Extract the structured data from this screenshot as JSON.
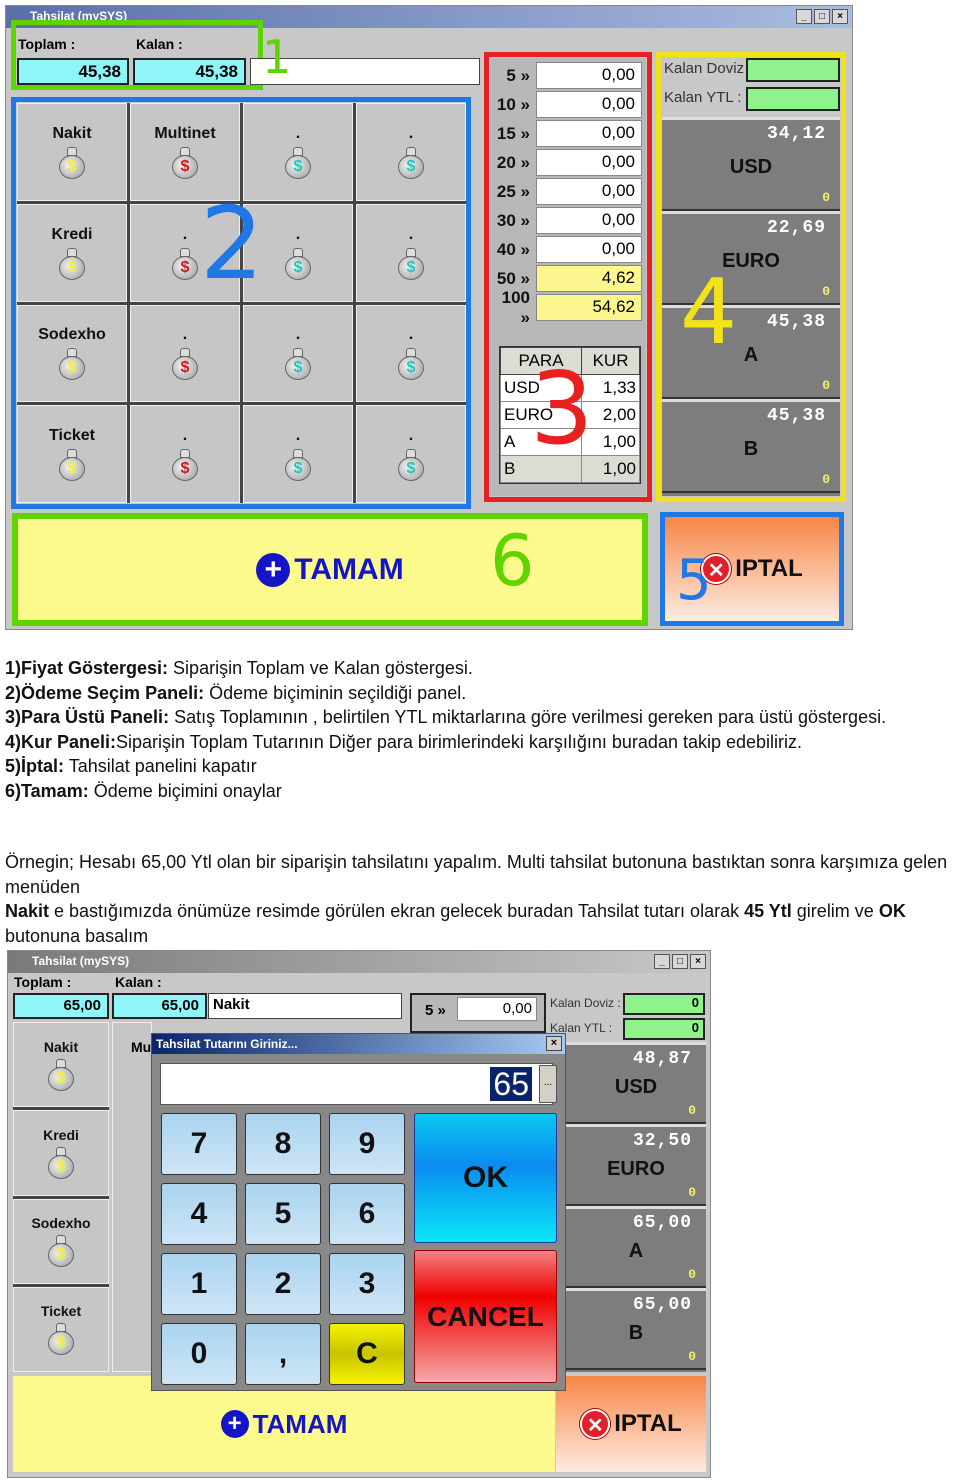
{
  "top_window": {
    "title": "Tahsilat (mySYS)",
    "toplam_label": "Toplam :",
    "kalan_label": "Kalan :",
    "toplam_value": "45,38",
    "kalan_value": "45,38",
    "method_value": "",
    "payment_grid": [
      {
        "label": "Nakit",
        "icon": "money-bag-yellow"
      },
      {
        "label": "Multinet",
        "icon": "money-bag-red"
      },
      {
        "label": ".",
        "icon": "money-bag-cyan"
      },
      {
        "label": ".",
        "icon": "money-bag-cyan"
      },
      {
        "label": "Kredi",
        "icon": "money-bag-yellow"
      },
      {
        "label": ".",
        "icon": "money-bag-red"
      },
      {
        "label": ".",
        "icon": "money-bag-cyan"
      },
      {
        "label": ".",
        "icon": "money-bag-cyan"
      },
      {
        "label": "Sodexho",
        "icon": "money-bag-yellow"
      },
      {
        "label": ".",
        "icon": "money-bag-red"
      },
      {
        "label": ".",
        "icon": "money-bag-cyan"
      },
      {
        "label": ".",
        "icon": "money-bag-cyan"
      },
      {
        "label": "Ticket",
        "icon": "money-bag-yellow"
      },
      {
        "label": ".",
        "icon": "money-bag-red"
      },
      {
        "label": ".",
        "icon": "money-bag-cyan"
      },
      {
        "label": ".",
        "icon": "money-bag-cyan"
      }
    ],
    "change_rows": [
      {
        "label": "5 »",
        "value": "0,00",
        "highlight": false
      },
      {
        "label": "10 »",
        "value": "0,00",
        "highlight": false
      },
      {
        "label": "15 »",
        "value": "0,00",
        "highlight": false
      },
      {
        "label": "20 »",
        "value": "0,00",
        "highlight": false
      },
      {
        "label": "25 »",
        "value": "0,00",
        "highlight": false
      },
      {
        "label": "30 »",
        "value": "0,00",
        "highlight": false
      },
      {
        "label": "40 »",
        "value": "0,00",
        "highlight": false
      },
      {
        "label": "50 »",
        "value": "4,62",
        "highlight": true
      },
      {
        "label": "100 »",
        "value": "54,62",
        "highlight": true
      }
    ],
    "rates_header": [
      "PARA",
      "KUR"
    ],
    "rates": [
      {
        "para": "USD",
        "kur": "1,33"
      },
      {
        "para": "EURO",
        "kur": "2,00"
      },
      {
        "para": "A",
        "kur": "1,00"
      },
      {
        "para": "B",
        "kur": "1,00"
      }
    ],
    "kalan_doviz_label": "Kalan Doviz :",
    "kalan_ytl_label": "Kalan YTL :",
    "kalan_doviz_value": "",
    "kalan_ytl_value": "",
    "currencies": [
      {
        "amount": "34,12",
        "name": "USD",
        "count": "0"
      },
      {
        "amount": "22,69",
        "name": "EURO",
        "count": "0"
      },
      {
        "amount": "45,38",
        "name": "A",
        "count": "0"
      },
      {
        "amount": "45,38",
        "name": "B",
        "count": "0"
      }
    ],
    "ok_label": "TAMAM",
    "cancel_label": "IPTAL",
    "annotations": [
      "1",
      "2",
      "3",
      "4",
      "5",
      "6"
    ]
  },
  "annotation_colors": {
    "1": "#5fd400",
    "2": "#1e78e6",
    "3": "#e82020",
    "4": "#f2e21a",
    "5": "#1e78e6",
    "6": "#5fd400"
  },
  "doc": {
    "items": [
      {
        "bold": "1)Fiyat Göstergesi:",
        "text": " Siparişin Toplam ve Kalan göstergesi."
      },
      {
        "bold": "2)Ödeme Seçim Paneli:",
        "text": " Ödeme biçiminin seçildiği panel."
      },
      {
        "bold": "3)Para Üstü Paneli:",
        "text": " Satış Toplamının , belirtilen YTL miktarlarına göre verilmesi gereken para üstü göstergesi."
      },
      {
        "bold": "4)Kur Paneli:",
        "text": "Siparişin Toplam Tutarının Diğer para birimlerindeki karşılığını buradan  takip edebiliriz."
      },
      {
        "bold": "5)İptal:",
        "text": " Tahsilat panelini kapatır"
      },
      {
        "bold": "6)Tamam:",
        "text": " Ödeme biçimini onaylar"
      }
    ],
    "para1": "Örnegin;  Hesabı  65,00   Ytl olan bir  siparişin tahsilatını yapalım. Multi tahsilat butonuna  bastıktan sonra  karşımıza  gelen menüden",
    "para2_b1": "Nakit",
    "para2_t1": " e     bastığımızda önümüze  resimde görülen ekran gelecek buradan Tahsilat tutarı olarak ",
    "para2_b2": "45 Ytl",
    "para2_t2": " girelim  ve ",
    "para2_b3": "OK",
    "para2_t3": " butonuna basalım"
  },
  "bottom_window": {
    "title": "Tahsilat (mySYS)",
    "toplam_label": "Toplam :",
    "kalan_label": "Kalan :",
    "toplam_value": "65,00",
    "kalan_value": "65,00",
    "method_value": "Nakit",
    "payment_labels": [
      "Nakit",
      "Kredi",
      "Sodexho",
      "Ticket"
    ],
    "partial_label": "Mu",
    "change_first": {
      "label": "5 »",
      "value": "0,00"
    },
    "kalan_doviz_label": "Kalan Doviz :",
    "kalan_ytl_label": "Kalan YTL :",
    "kalan_doviz_value": "0",
    "kalan_ytl_value": "0",
    "currencies": [
      {
        "amount": "48,87",
        "name": "USD",
        "count": "0"
      },
      {
        "amount": "32,50",
        "name": "EURO",
        "count": "0"
      },
      {
        "amount": "65,00",
        "name": "A",
        "count": "0"
      },
      {
        "amount": "65,00",
        "name": "B",
        "count": "0"
      }
    ],
    "ok_label": "TAMAM",
    "cancel_label": "IPTAL"
  },
  "dialog": {
    "title": "Tahsilat Tutarını Giriniz...",
    "input_value": "65",
    "ellipsis": "...",
    "keys": [
      "7",
      "8",
      "9",
      "4",
      "5",
      "6",
      "1",
      "2",
      "3",
      "0",
      ",",
      "C"
    ],
    "ok_label": "OK",
    "cancel_label": "CANCEL"
  }
}
